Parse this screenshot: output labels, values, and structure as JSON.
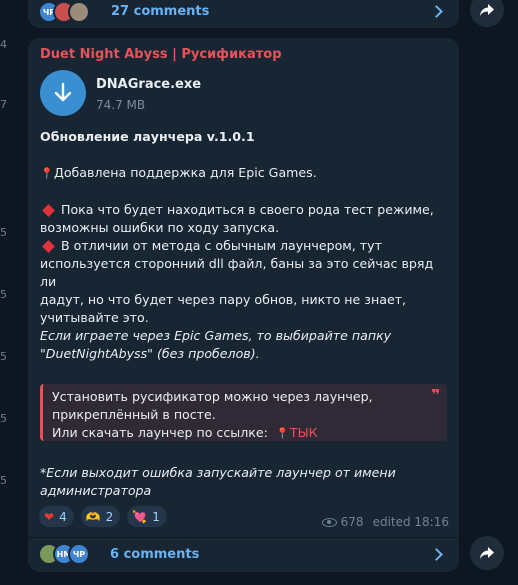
{
  "edge_chars": [
    {
      "char": "4"
    },
    {
      "char": "7"
    },
    {
      "char": "5"
    },
    {
      "char": "5"
    },
    {
      "char": "5"
    },
    {
      "char": "5"
    },
    {
      "char": "5"
    }
  ],
  "previous_post": {
    "avatars": [
      {
        "label": "ЧР",
        "color": "#3e86d1"
      },
      {
        "label": "",
        "color": "#c94f4f"
      },
      {
        "label": "",
        "color": "#9a8b7a"
      }
    ],
    "comments_label": "27 comments"
  },
  "post": {
    "channel_name": "Duet Night Abyss | Русификатор",
    "file": {
      "name": "DNAGrace.exe",
      "size": "74.7 MB"
    },
    "heading": "Обновление лаунчера v.1.0.1",
    "bullet_pin": "Добавлена поддержка для Epic Games.",
    "bullet1_line1": "Пока что будет находиться в своего рода тест режиме,",
    "bullet1_line2": "возможны ошибки по ходу запуска.",
    "bullet2_line1": "В отличии от метода с обычным лаунчером, тут",
    "bullet2_line2": "используется сторонний dll файл, баны за это сейчас вряд ли",
    "bullet2_line3": "дадут, но что будет через пару обнов, никто не знает,",
    "bullet2_line4": "учитывайте это.",
    "italic_line1": "Если играете через Epic Games, то выбирайте папку",
    "italic_line2": "\"DuetNightAbyss\" (без пробелов).",
    "quote_line1": "Установить русификатор можно через лаунчер,",
    "quote_line2": "прикреплённый в посте.",
    "quote_line3_prefix": "Или скачать лаунчер по ссылке:",
    "quote_link": "ТЫК",
    "footnote_line1": "*Если выходит ошибка запускайте лаунчер от имени",
    "footnote_line2": "администратора",
    "reactions": [
      {
        "emoji": "❤",
        "count": "4"
      },
      {
        "emoji": "🫶",
        "count": "2"
      },
      {
        "emoji": "💘",
        "count": "1"
      }
    ],
    "views": "678",
    "edited": "edited 18:16",
    "avatars": [
      {
        "label": "",
        "color": "#7a9a5a"
      },
      {
        "label": "НМ",
        "color": "#3e86d1"
      },
      {
        "label": "ЧР",
        "color": "#3e86d1"
      }
    ],
    "comments_label": "6 comments"
  }
}
